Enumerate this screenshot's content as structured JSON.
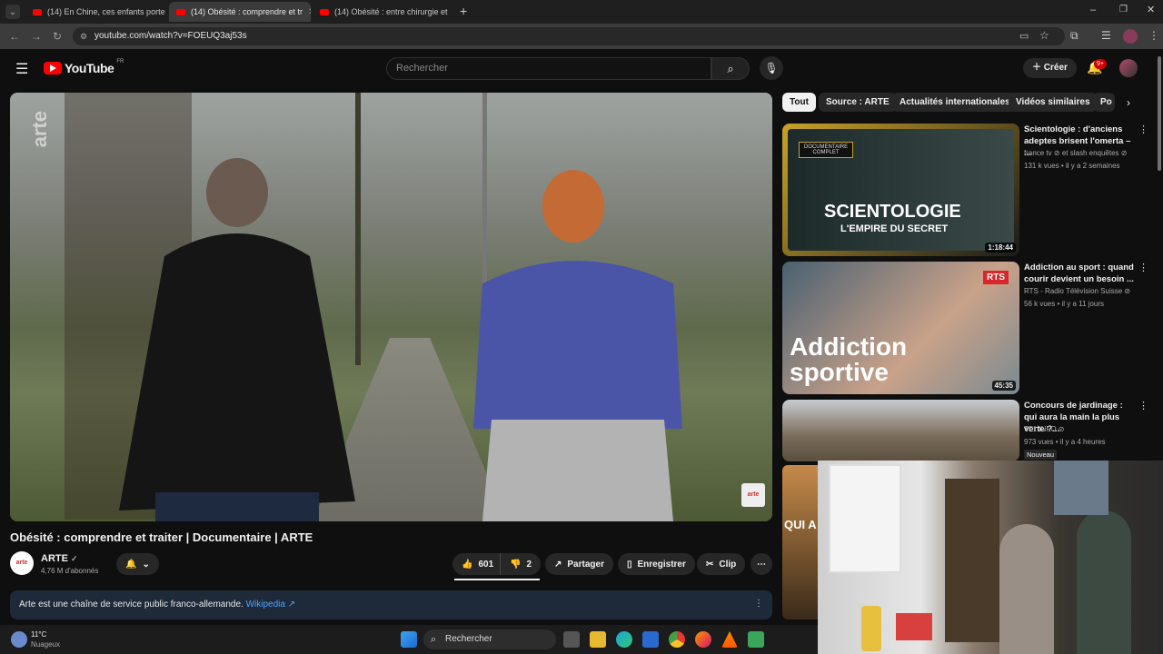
{
  "browser": {
    "tabs": [
      {
        "label": "(14) En Chine, ces enfants porte"
      },
      {
        "label": "(14) Obésité : comprendre et tr"
      },
      {
        "label": "(14) Obésité : entre chirurgie et"
      }
    ],
    "url": "youtube.com/watch?v=FOEUQ3aj53s"
  },
  "header": {
    "logo": "YouTube",
    "region": "FR",
    "search_placeholder": "Rechercher",
    "create_label": "Créer",
    "notif_badge": "9+"
  },
  "video": {
    "title": "Obésité : comprendre et traiter | Documentaire | ARTE",
    "watermark": "arte",
    "channel": "ARTE",
    "subscribers": "4,76 M d'abonnés",
    "likes": "601",
    "dislikes": "2",
    "share_label": "Partager",
    "save_label": "Enregistrer",
    "clip_label": "Clip",
    "description": "Arte est une chaîne de service public franco-allemande.",
    "wiki_link": "Wikipedia ↗"
  },
  "chips": [
    "Tout",
    "Source : ARTE",
    "Actualités internationales",
    "Vidéos similaires",
    "Po"
  ],
  "recommendations": [
    {
      "title": "Scientologie : d'anciens adeptes brisent l'omerta – ...",
      "channel": "france tv ⊘ et slash enquêtes ⊘",
      "meta": "131 k vues • il y a 2 semaines",
      "duration": "1:18:44",
      "thumb_text": "SCIENTOLOGIE",
      "thumb_sub": "L'EMPIRE DU SECRET",
      "thumb_badge": "DOCUMENTAIRE COMPLET"
    },
    {
      "title": "Addiction au sport : quand courir devient un besoin ...",
      "channel": "RTS - Radio Télévision Suisse ⊘",
      "meta": "56 k vues • il y a 11 jours",
      "duration": "45:35",
      "thumb_text": "Addiction sportive",
      "thumb_badge": "RTS"
    },
    {
      "title": "Concours de jardinage : qui aura la main la plus verte ?...",
      "channel": "TF1 INFO ⊘",
      "meta": "973 vues • il y a 4 heures",
      "badge": "Nouveau"
    }
  ],
  "partial_rec_text": "QUI A",
  "taskbar": {
    "temp": "11°C",
    "weather": "Nuageux",
    "search": "Rechercher"
  }
}
